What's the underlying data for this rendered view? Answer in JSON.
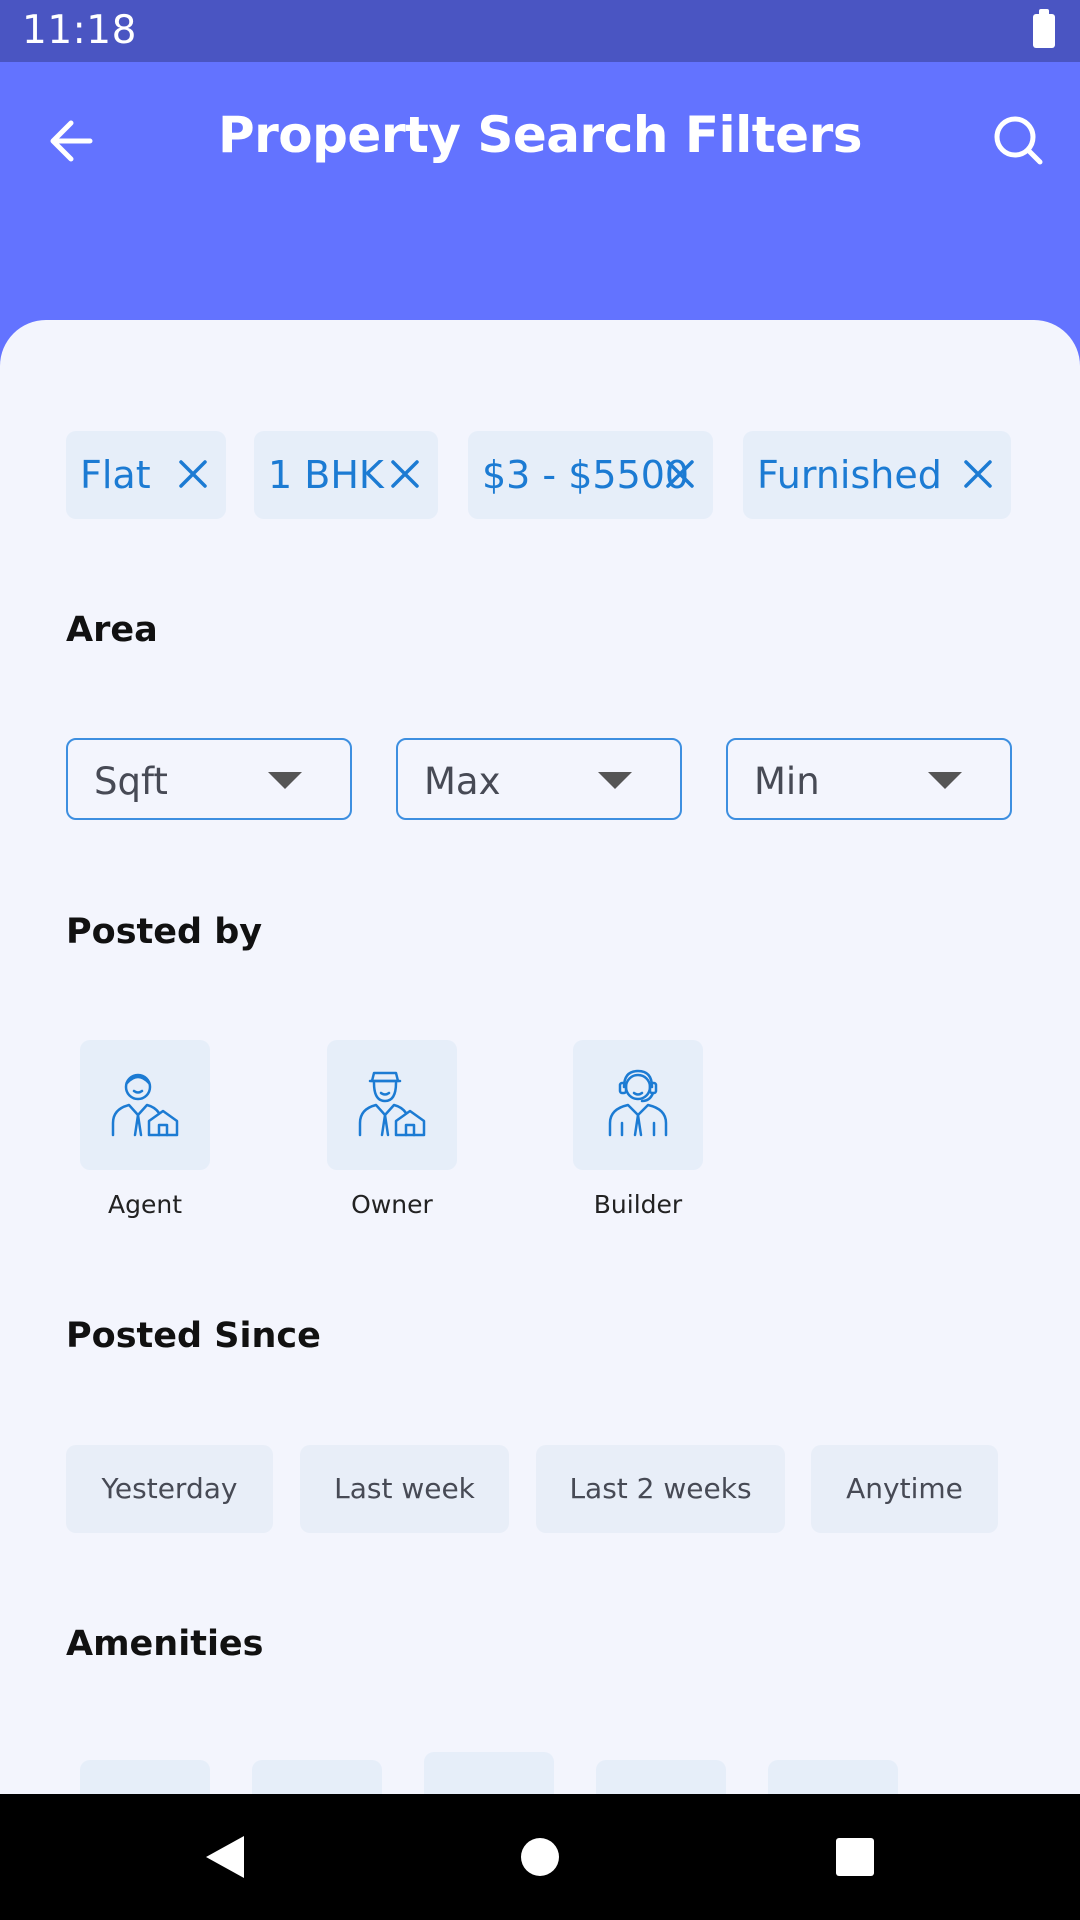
{
  "status_bar": {
    "time": "11:18"
  },
  "app_bar": {
    "title": "Property Search Filters",
    "back_icon": "arrow-left-icon",
    "search_icon": "search-icon"
  },
  "colors": {
    "primary": "#6373ff",
    "status_bar": "#4a55c2",
    "accent": "#1c7bd3",
    "sheet_bg": "#f3f5fd",
    "chip_bg": "#e6eef9"
  },
  "selected_filters": [
    {
      "label": "Flat"
    },
    {
      "label": "1 BHK"
    },
    {
      "label": "$3 - $5500"
    },
    {
      "label": "Furnished"
    }
  ],
  "area": {
    "title": "Area",
    "dropdowns": [
      {
        "label": "Sqft"
      },
      {
        "label": "Max"
      },
      {
        "label": "Min"
      }
    ]
  },
  "posted_by": {
    "title": "Posted by",
    "options": [
      {
        "label": "Agent",
        "icon": "agent-icon"
      },
      {
        "label": "Owner",
        "icon": "owner-icon"
      },
      {
        "label": "Builder",
        "icon": "builder-icon"
      }
    ]
  },
  "posted_since": {
    "title": "Posted Since",
    "options": [
      {
        "label": "Yesterday"
      },
      {
        "label": "Last week"
      },
      {
        "label": "Last 2 weeks"
      },
      {
        "label": "Anytime"
      }
    ]
  },
  "amenities": {
    "title": "Amenities"
  },
  "nav_bar": {
    "back_icon": "nav-back-icon",
    "home_icon": "nav-home-icon",
    "recents_icon": "nav-recents-icon"
  }
}
